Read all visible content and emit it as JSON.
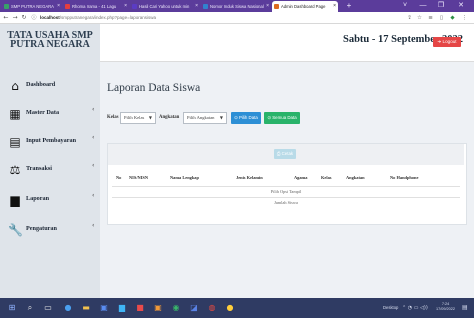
{
  "browser": {
    "tabs": [
      {
        "label": "SMP PUTRA NEGARA",
        "active": false,
        "favicon_color": "#38a169"
      },
      {
        "label": "Rhoma Irama - 41 Lagu",
        "active": false,
        "favicon_color": "#e53e3e"
      },
      {
        "label": "Hasil Cari Yahoo untuk min",
        "active": false,
        "favicon_color": "#5b3cc4"
      },
      {
        "label": "Nomor Induk Siswa Nasional",
        "active": false,
        "favicon_color": "#3182ce"
      },
      {
        "label": "Admin Dashboard Page",
        "active": false,
        "favicon_color": "#dd6b20"
      }
    ],
    "url_host": "localhost",
    "url_path": "/smpputranegara/index.php?page=laporansiswa",
    "window_controls": [
      "˅",
      "—",
      "❐",
      "✕"
    ]
  },
  "header": {
    "brand_line1": "TATA USAHA SMP",
    "brand_line2": "PUTRA NEGARA",
    "date_title": "Sabtu - 17 September 2022",
    "logout_label": "➜ Logout"
  },
  "sidebar": {
    "items": [
      {
        "label": "Dashboard",
        "icon": "home-icon",
        "glyph": "⌂",
        "arrow": false
      },
      {
        "label": "Master Data",
        "icon": "table-icon",
        "glyph": "▦",
        "arrow": true
      },
      {
        "label": "Input Pembayaran",
        "icon": "money-icon",
        "glyph": "▤",
        "arrow": true
      },
      {
        "label": "Transaksi",
        "icon": "scale-icon",
        "glyph": "⚖",
        "arrow": true
      },
      {
        "label": "Laporan",
        "icon": "file-icon",
        "glyph": "▆",
        "arrow": true
      },
      {
        "label": "Pengaturan",
        "icon": "wrench-icon",
        "glyph": "🔧",
        "arrow": true
      }
    ],
    "arrow_glyph": "‹"
  },
  "main": {
    "title": "Laporan Data Siswa",
    "filters": {
      "kelas_label": "Kelas",
      "kelas_value": "Pilih Kelas",
      "angkatan_label": "Angkatan",
      "angkatan_value": "Pilih Angkatan",
      "btn_pilih_data": "⊙ Pilih Data",
      "btn_semua_data": "⊙ Semua Data"
    },
    "table": {
      "cetak_label": "⎙ Cetak",
      "columns": [
        "No",
        "NIS/NISN",
        "Nama Lengkap",
        "Jenis Kelamin",
        "Agama",
        "Kelas",
        "Angkatan",
        "No Handphone"
      ],
      "empty_row": "Pilih Opsi Tampil",
      "total_row": "Jumlah Siswa"
    }
  },
  "taskbar": {
    "desktop_label": "Desktop",
    "time": "7:24",
    "date": "17/09/2022"
  },
  "colors": {
    "tab_bar": "#5b3c9b",
    "logout_red": "#e54646",
    "pilih_blue": "#2d8fd5",
    "semua_green": "#29b36a",
    "cetak_light": "#b9dbe8",
    "sidebar": "#dfe4ea",
    "taskbar": "#2f3b63"
  }
}
